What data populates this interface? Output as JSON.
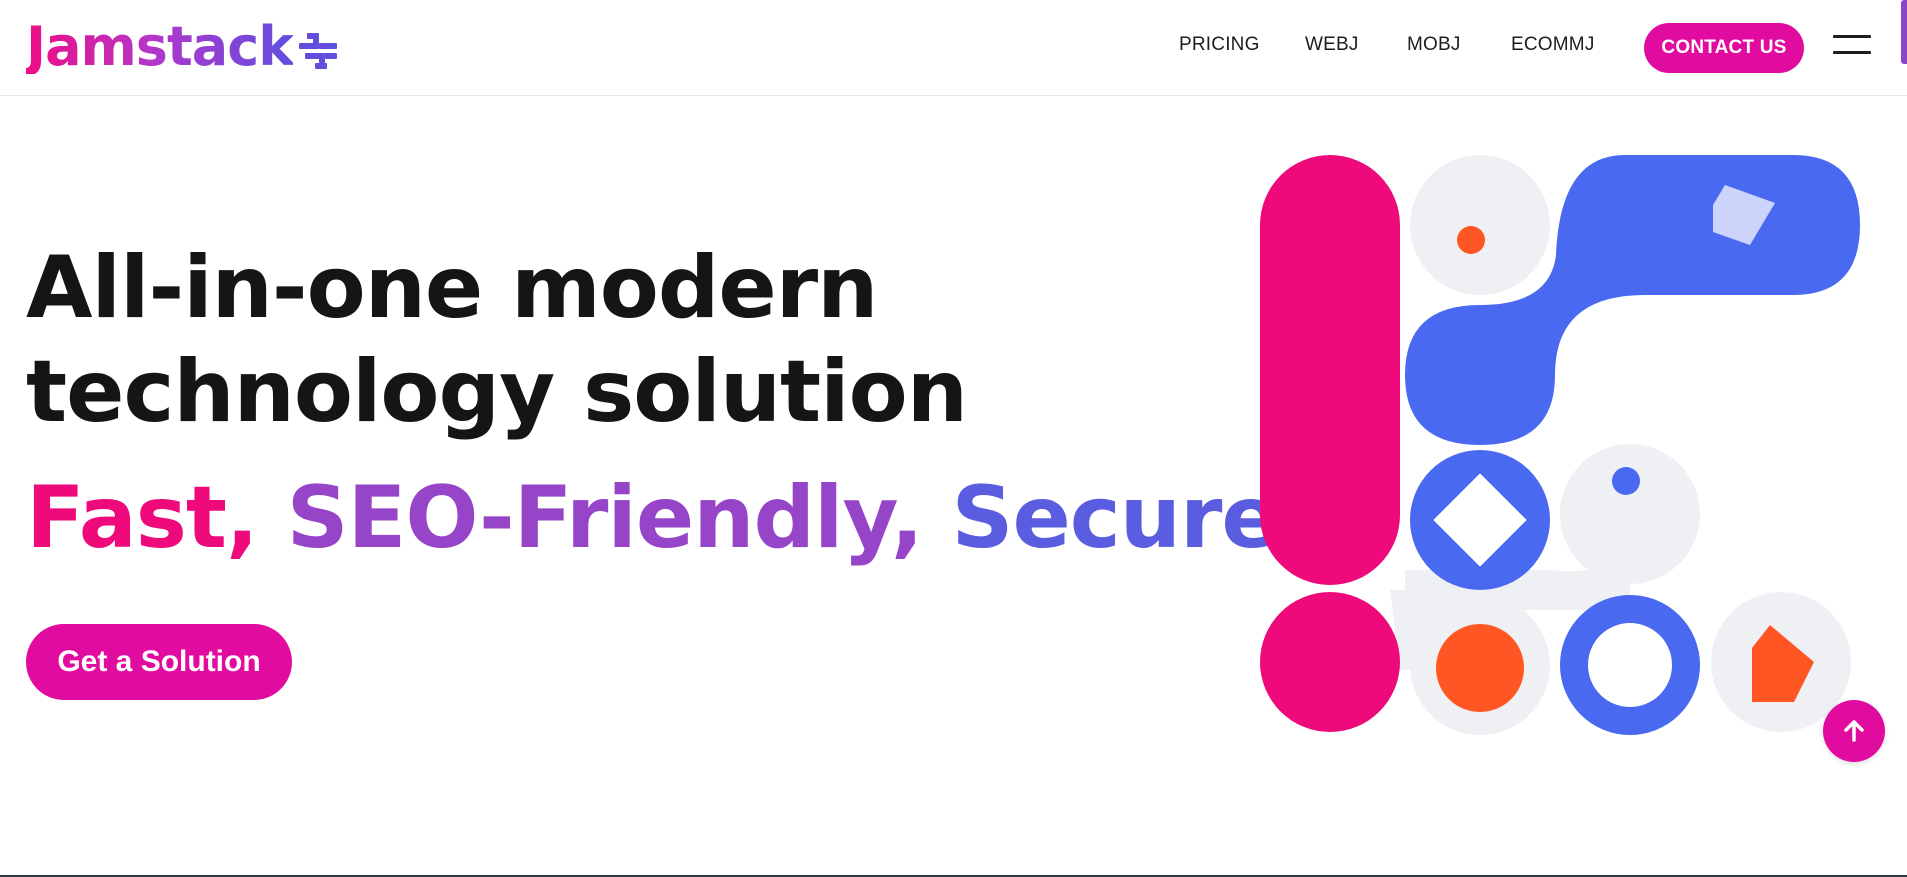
{
  "header": {
    "logo_text": "Jamstack",
    "nav": [
      "PRICING",
      "WEBJ",
      "MOBJ",
      "ECOMMJ"
    ],
    "contact_label": "CONTACT US"
  },
  "hero": {
    "headline_line1": "All-in-one modern",
    "headline_line2": "technology solution",
    "tagline_part1": "Fast,",
    "tagline_part2": "SEO-Friendly,",
    "tagline_part3": "Secure!",
    "cta_label": "Get a Solution"
  },
  "colors": {
    "brand_pink": "#e20ba0",
    "hot_pink": "#ee0a7a",
    "purple": "#9645c8",
    "blue": "#4a69f1",
    "orange": "#ff5624",
    "light_gray": "#eff0f4",
    "lavender": "#cdd4fb"
  },
  "icons": {
    "logo_mark": "jamstack-logo-icon",
    "menu": "hamburger-menu-icon",
    "scroll_top": "arrow-up-icon"
  }
}
